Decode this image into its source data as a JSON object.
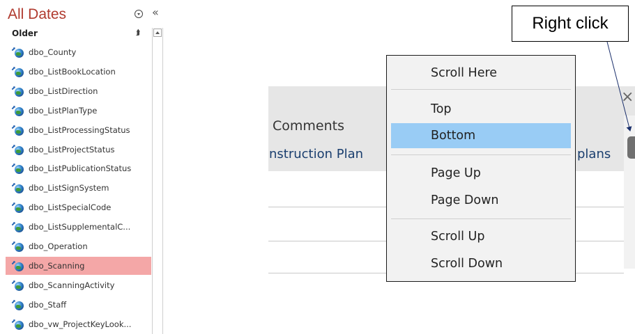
{
  "nav": {
    "title": "All Dates",
    "group_header": "Older",
    "items": [
      {
        "label": "dbo_County"
      },
      {
        "label": "dbo_ListBookLocation"
      },
      {
        "label": "dbo_ListDirection"
      },
      {
        "label": "dbo_ListPlanType"
      },
      {
        "label": "dbo_ListProcessingStatus"
      },
      {
        "label": "dbo_ListProjectStatus"
      },
      {
        "label": "dbo_ListPublicationStatus"
      },
      {
        "label": "dbo_ListSignSystem"
      },
      {
        "label": "dbo_ListSpecialCode"
      },
      {
        "label": "dbo_ListSupplementalC..."
      },
      {
        "label": "dbo_Operation"
      },
      {
        "label": "dbo_Scanning",
        "selected": true
      },
      {
        "label": "dbo_ScanningActivity"
      },
      {
        "label": "dbo_Staff"
      },
      {
        "label": "dbo_vw_ProjectKeyLook..."
      }
    ],
    "selected_color": "#f4a7a7"
  },
  "form": {
    "column_header": "Comments",
    "field_value_left": "nstruction Plan",
    "field_value_right": "plans"
  },
  "context_menu": {
    "items": [
      {
        "label": "Scroll Here"
      },
      {
        "label": "Top"
      },
      {
        "label": "Bottom",
        "highlighted": true
      },
      {
        "label": "Page Up"
      },
      {
        "label": "Page Down"
      },
      {
        "label": "Scroll Up"
      },
      {
        "label": "Scroll Down"
      }
    ],
    "highlight_color": "#99ccf5"
  },
  "callout": {
    "text": "Right click"
  }
}
